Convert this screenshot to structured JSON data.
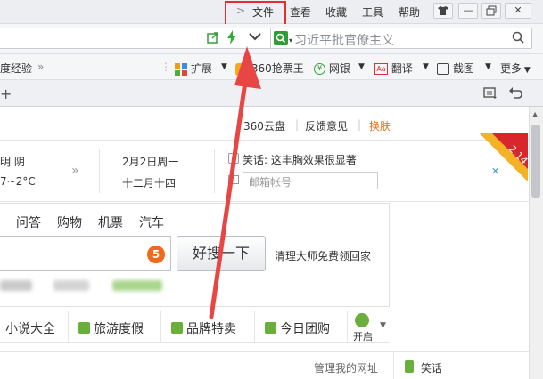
{
  "titlebar": {
    "menu": [
      "文件",
      "查看",
      "收藏",
      "工具",
      "帮助"
    ],
    "chevron": ">"
  },
  "addressbar": {
    "search_placeholder": "习近平批官僚主义"
  },
  "favorites": {
    "left_item": "度经验",
    "items": [
      "扩展",
      "360抢票王",
      "网银",
      "翻译",
      "截图",
      "更多"
    ]
  },
  "content": {
    "top_links": [
      "360云盘",
      "反馈意见",
      "换肤"
    ],
    "weather": {
      "condition": "明 阴",
      "temp": "7~2°C",
      "date": "2月2日周一",
      "lunar": "十二月十四",
      "joke_label": "笑话: 这丰胸效果很显著",
      "email_placeholder": "邮箱帐号"
    },
    "search_tabs": [
      "问答",
      "购物",
      "机票",
      "汽车"
    ],
    "badge": "5",
    "search_button": "好搜一下",
    "promo": "清理大师免费领回家",
    "links": [
      "小说大全",
      "旅游度假",
      "品牌特卖",
      "今日团购"
    ],
    "enable_label": "开启",
    "manage_sites": "管理我的网址",
    "joke_tab": "笑话",
    "ribbon_text": "2.14"
  },
  "colors": {
    "highlight_red": "#e03030",
    "accent_orange": "#f06a1b",
    "link_green": "#6aae3c",
    "arrow_red": "#e84545"
  }
}
